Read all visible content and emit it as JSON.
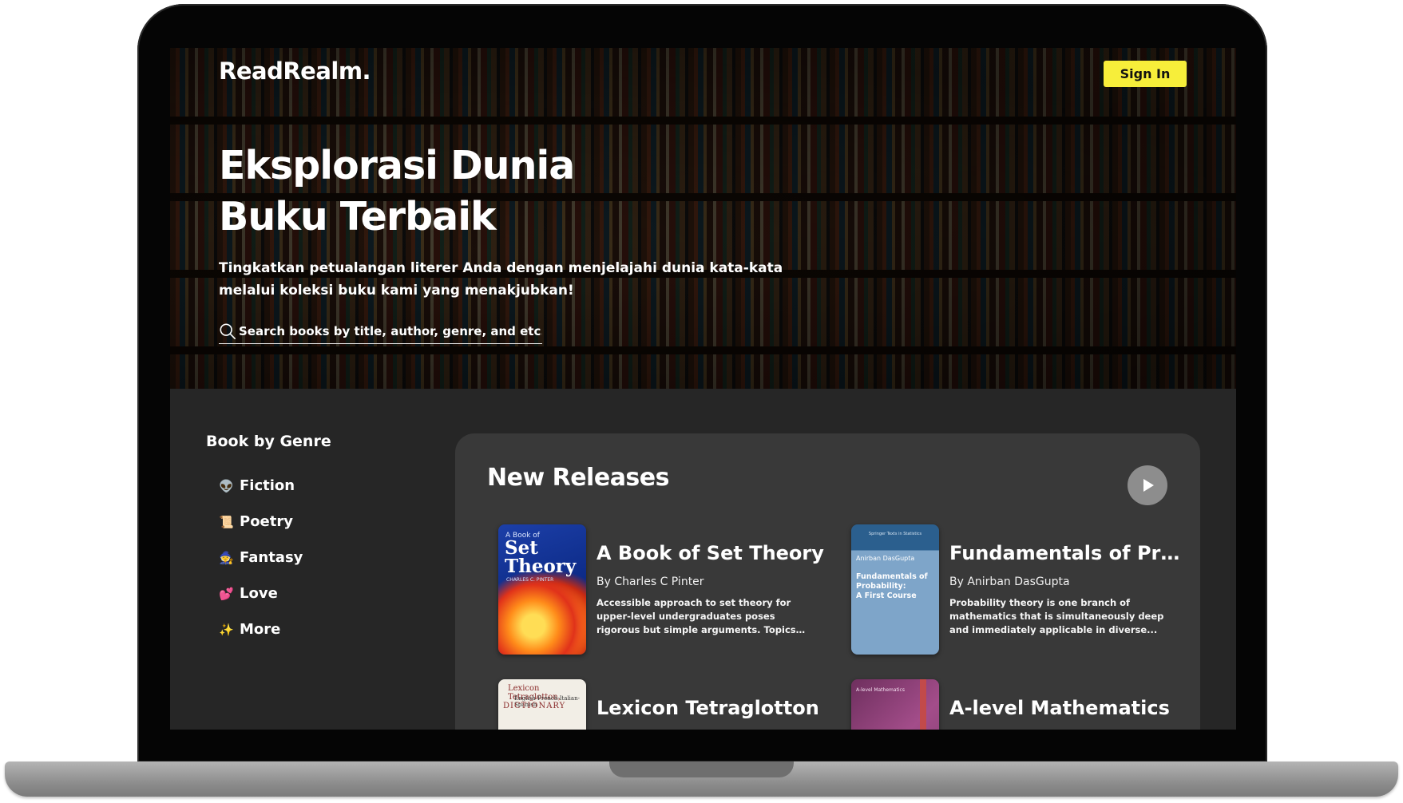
{
  "brand": "ReadRealm.",
  "header": {
    "signin_label": "Sign In"
  },
  "hero": {
    "title": "Eksplorasi Dunia Buku Terbaik",
    "subtitle": "Tingkatkan petualangan literer Anda dengan menjelajahi dunia kata-kata melalui koleksi buku kami yang menakjubkan!",
    "search_placeholder": "Search books by title, author, genre, and etc..."
  },
  "genres": {
    "title": "Book by Genre",
    "items": [
      {
        "emoji": "👽",
        "label": "Fiction"
      },
      {
        "emoji": "📜",
        "label": "Poetry"
      },
      {
        "emoji": "🧙",
        "label": "Fantasy"
      },
      {
        "emoji": "💕",
        "label": "Love"
      },
      {
        "emoji": "✨",
        "label": "More"
      }
    ]
  },
  "new_releases": {
    "title": "New Releases",
    "play_icon": "play-icon",
    "books": [
      {
        "title": "A Book of Set Theory",
        "author": "By Charles C Pinter",
        "description": "Accessible approach to set theory for upper-level undergraduates poses rigorous but simple arguments. Topics include...",
        "cover": {
          "small": "A Book of",
          "big1": "Set",
          "big2": "Theory",
          "author": "CHARLES C. PINTER"
        }
      },
      {
        "title": "Fundamentals of Probability: A First Course",
        "author": "By Anirban DasGupta",
        "description": "Probability theory is one branch of mathematics that is simultaneously deep and immediately applicable in diverse...",
        "cover": {
          "top": "Springer Texts in Statistics",
          "author": "Anirban DasGupta",
          "title1": "Fundamentals of",
          "title2": "Probability:",
          "title3": "A First Course"
        }
      },
      {
        "title": "Lexicon Tetraglotton",
        "author": "",
        "description": "",
        "cover": {
          "a": "Lexicon Tetraglotton,",
          "b": "English-French-Italian-Spanish",
          "c": "DICTIONARY"
        }
      },
      {
        "title": "A-level Mathematics",
        "author": "",
        "description": "",
        "cover": {
          "a": "A-level Mathematics"
        }
      }
    ]
  }
}
